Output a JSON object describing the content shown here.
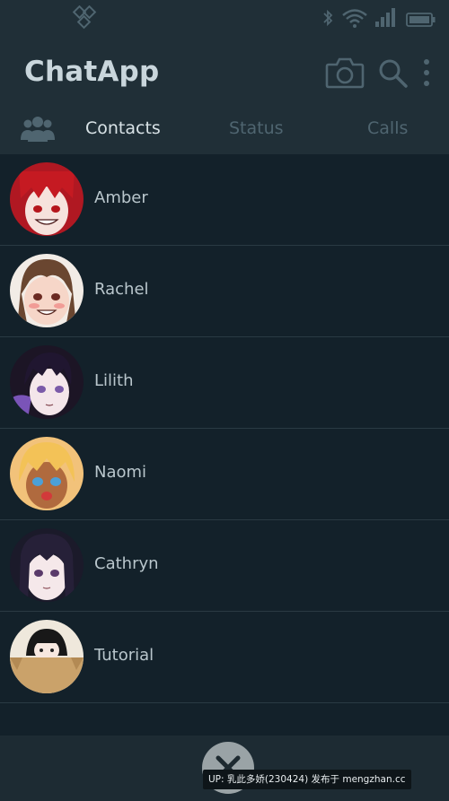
{
  "app": {
    "title": "ChatApp"
  },
  "tabs": [
    {
      "label": "Contacts",
      "active": true
    },
    {
      "label": "Status",
      "active": false
    },
    {
      "label": "Calls",
      "active": false
    }
  ],
  "contacts": [
    {
      "name": "Amber"
    },
    {
      "name": "Rachel"
    },
    {
      "name": "Lilith"
    },
    {
      "name": "Naomi"
    },
    {
      "name": "Cathryn"
    },
    {
      "name": "Tutorial"
    }
  ],
  "overlay": {
    "credit": "UP: 乳此多娇(230424) 发布于 mengzhan.cc"
  },
  "colors": {
    "header": "#202f37",
    "background": "#13212a",
    "active_tab": "#d8e2e6",
    "inactive_tab": "#4f6570"
  },
  "icons": [
    "app-logo-icon",
    "bluetooth-icon",
    "wifi-icon",
    "signal-icon",
    "battery-icon",
    "camera-icon",
    "search-icon",
    "more-vert-icon",
    "group-icon",
    "close-icon"
  ]
}
